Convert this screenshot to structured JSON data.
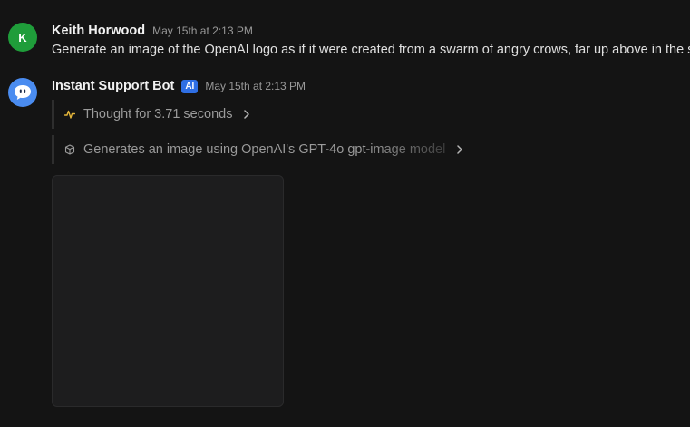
{
  "messages": [
    {
      "avatar_letter": "K",
      "author": "Keith Horwood",
      "timestamp": "May 15th at 2:13 PM",
      "text": "Generate an image of the OpenAI logo as if it were created from a swarm of angry crows, far up above in the sky."
    },
    {
      "author": "Instant Support Bot",
      "badge": "AI",
      "timestamp": "May 15th at 2:13 PM",
      "steps": [
        {
          "icon": "activity-icon",
          "text": "Thought for 3.71 seconds"
        },
        {
          "icon": "cube-icon",
          "text": "Generates an image using OpenAI's GPT-4o gpt-image model"
        }
      ]
    }
  ],
  "colors": {
    "background": "#141414",
    "user_avatar": "#1f9d3a",
    "bot_avatar": "#4a8cf0",
    "ai_badge": "#2f6fe4",
    "thought_icon": "#e3b53a"
  }
}
